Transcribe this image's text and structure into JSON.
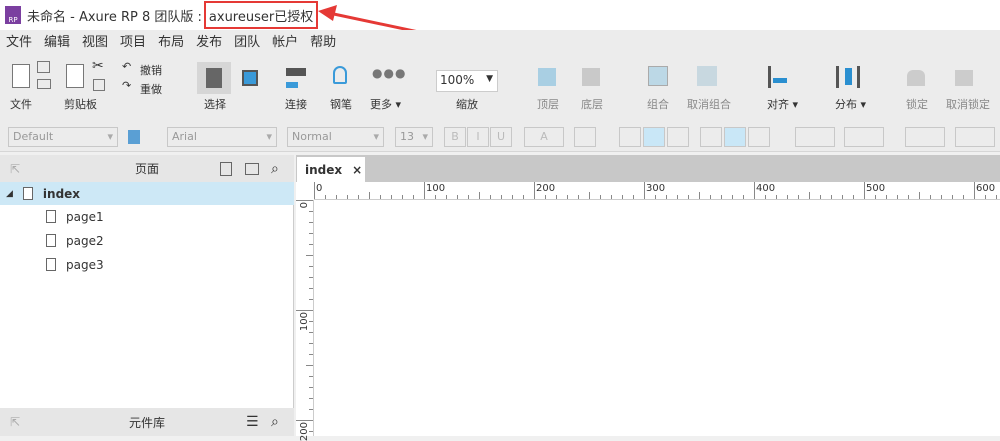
{
  "title": {
    "app_icon": "RP",
    "main": "未命名 - Axure RP 8 团队版 : ",
    "license": "axureuser已授权"
  },
  "menu": [
    "文件",
    "编辑",
    "视图",
    "项目",
    "布局",
    "发布",
    "团队",
    "帐户",
    "帮助"
  ],
  "toolbar": {
    "file": "文件",
    "clipboard": "剪贴板",
    "undo": "撤销",
    "redo": "重做",
    "select": "选择",
    "connect": "连接",
    "pen": "钢笔",
    "more": "更多 ▾",
    "zoom_value": "100%",
    "zoom": "缩放",
    "top": "顶层",
    "bottom": "底层",
    "group": "组合",
    "ungroup": "取消组合",
    "align": "对齐 ▾",
    "distribute": "分布 ▾",
    "lock": "锁定",
    "unlock": "取消锁定"
  },
  "format": {
    "style": "Default",
    "font": "Arial",
    "weight": "Normal",
    "size": "13",
    "bold": "B",
    "italic": "I",
    "underline": "U",
    "fontcolor": "A"
  },
  "pages": {
    "title": "页面",
    "items": [
      {
        "label": "index"
      },
      {
        "label": "page1"
      },
      {
        "label": "page2"
      },
      {
        "label": "page3"
      }
    ]
  },
  "library": {
    "title": "元件库"
  },
  "canvas": {
    "tab": "index",
    "tab_close": "×",
    "hticks": [
      "0",
      "100",
      "200",
      "300",
      "400",
      "500",
      "600"
    ],
    "vticks": [
      "0",
      "100",
      "200"
    ]
  }
}
